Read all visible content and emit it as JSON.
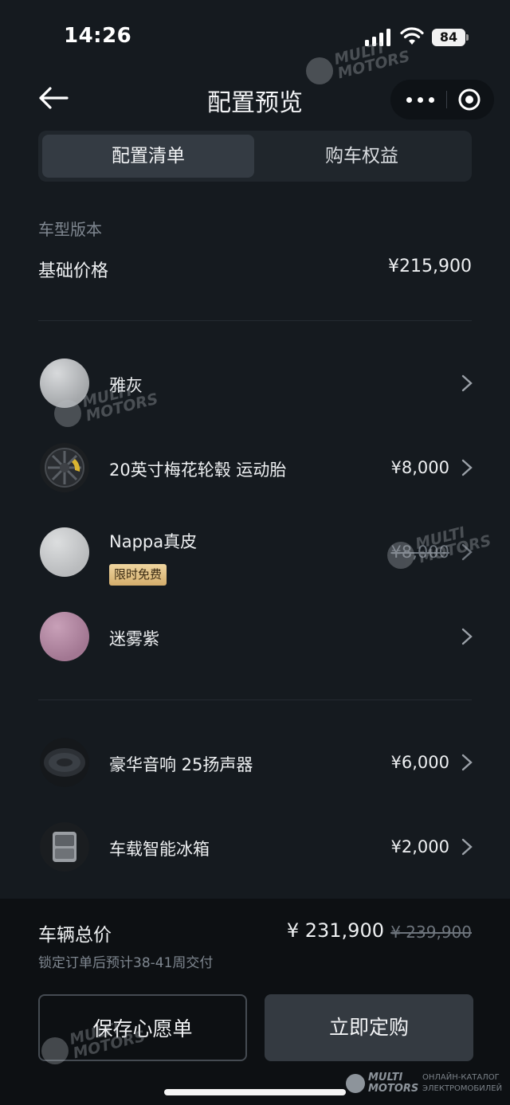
{
  "status_bar": {
    "time": "14:26",
    "battery": "84"
  },
  "nav": {
    "title": "配置预览"
  },
  "tabs": [
    {
      "label": "配置清单",
      "active": true
    },
    {
      "label": "购车权益",
      "active": false
    }
  ],
  "section": {
    "label": "车型版本",
    "base_label": "基础价格",
    "base_price": "¥215,900"
  },
  "options_group1": [
    {
      "name": "雅灰",
      "price": "",
      "badge": "",
      "color": "#b8babc"
    },
    {
      "name": "20英寸梅花轮毂 运动胎",
      "price": "¥8,000",
      "badge": "",
      "icon": "wheel-icon"
    },
    {
      "name": "Nappa真皮",
      "price": "¥8,000",
      "price_struck": true,
      "badge": "限时免费",
      "color": "#c9cbcd"
    },
    {
      "name": "迷雾紫",
      "price": "",
      "badge": "",
      "color": "#b58aa6"
    }
  ],
  "options_group2": [
    {
      "name": "豪华音响 25扬声器",
      "price": "¥6,000",
      "icon": "speaker-icon"
    },
    {
      "name": "车载智能冰箱",
      "price": "¥2,000",
      "icon": "fridge-icon"
    }
  ],
  "footer": {
    "total_label": "车辆总价",
    "total_price": "¥ 231,900",
    "original_price": "¥ 239,900",
    "delivery_note": "锁定订单后预计38-41周交付",
    "save_button": "保存心愿单",
    "buy_button": "立即定购"
  },
  "watermark": {
    "brand_line1": "MULTI",
    "brand_line2": "MOTORS",
    "corner_line1": "ОНЛАЙН-КАТАЛОГ",
    "corner_line2": "ЭЛЕКТРОМОБИЛЕЙ"
  },
  "colors": {
    "background": "#151a1f",
    "footer": "#0d1013",
    "badge": "#d3ad6c"
  }
}
